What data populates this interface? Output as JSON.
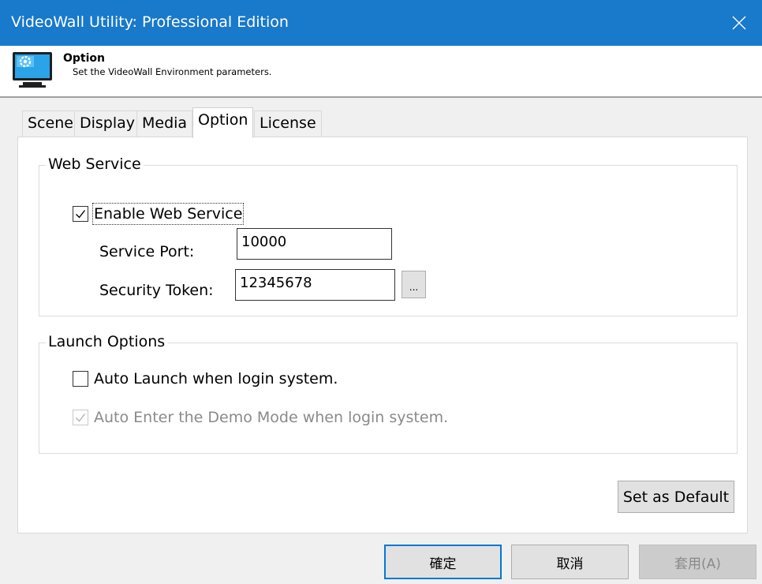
{
  "window": {
    "title": "VideoWall Utility: Professional Edition"
  },
  "header": {
    "title": "Option",
    "subtitle": "Set the VideoWall Environment parameters."
  },
  "tabs": [
    {
      "label": "Scene",
      "active": false
    },
    {
      "label": "Display",
      "active": false
    },
    {
      "label": "Media",
      "active": false
    },
    {
      "label": "Option",
      "active": true
    },
    {
      "label": "License",
      "active": false
    }
  ],
  "web_service": {
    "group_label": "Web Service",
    "enable_label": "Enable Web Service",
    "enable_checked": true,
    "port_label": "Service Port:",
    "port_value": "10000",
    "token_label": "Security Token:",
    "token_value": "12345678",
    "browse_label": "..."
  },
  "launch_options": {
    "group_label": "Launch Options",
    "auto_launch_label": "Auto Launch when login system.",
    "auto_launch_checked": false,
    "auto_demo_label": "Auto Enter the Demo Mode when login system.",
    "auto_demo_checked": true,
    "auto_demo_enabled": false
  },
  "buttons": {
    "set_default": "Set as Default",
    "ok": "確定",
    "cancel": "取消",
    "apply": "套用(A)"
  },
  "colors": {
    "titlebar": "#1979ca",
    "primary_border": "#0078d7",
    "disabled_text": "#8a8a8a"
  },
  "icons": {
    "close": "close-icon",
    "app": "monitor-gear-icon",
    "check": "checkmark-icon"
  }
}
